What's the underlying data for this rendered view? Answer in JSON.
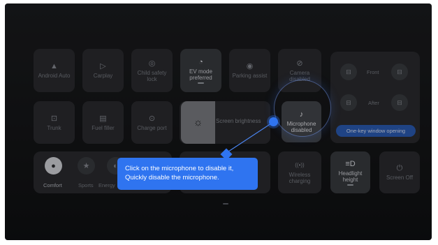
{
  "tiles_row1": [
    {
      "label": "Android Auto",
      "icon": "android-auto-icon",
      "glyph": "▲"
    },
    {
      "label": "Carplay",
      "icon": "carplay-icon",
      "glyph": "▷"
    },
    {
      "label": "Child safety lock",
      "icon": "child-lock-icon",
      "glyph": "◎"
    },
    {
      "label": "EV mode preferred",
      "icon": "ev-mode-icon",
      "glyph": "◔"
    },
    {
      "label": "Parking assist",
      "icon": "parking-assist-icon",
      "glyph": "◉"
    },
    {
      "label": "Camera disabled",
      "icon": "camera-disabled-icon",
      "glyph": "⊘"
    }
  ],
  "tiles_row2": [
    {
      "label": "Trunk",
      "icon": "trunk-icon",
      "glyph": "⊡"
    },
    {
      "label": "Fuel filler",
      "icon": "fuel-filler-icon",
      "glyph": "▤"
    },
    {
      "label": "Charge port",
      "icon": "charge-port-icon",
      "glyph": "⊙"
    }
  ],
  "brightness": {
    "label": "Screen brightness",
    "icon": "sun-icon",
    "glyph": "☼",
    "level_percent": 38
  },
  "microphone": {
    "label": "Microphone disabled",
    "icon": "microphone-disabled-icon",
    "glyph": "♪"
  },
  "window": {
    "front_label": "Front",
    "after_label": "After",
    "one_key_label": "One-key window opening",
    "icon_glyph": "⊟"
  },
  "drive_modes": [
    {
      "label": "Comfort",
      "icon": "comfort-mode-icon",
      "glyph": "●"
    },
    {
      "label": "Sports",
      "icon": "sports-mode-icon",
      "glyph": "★"
    },
    {
      "label": "Energy",
      "icon": "energy-mode-icon",
      "glyph": "◐"
    }
  ],
  "row3": [
    {
      "label": "Wireless charging",
      "icon": "wireless-charging-icon",
      "glyph": "((•))"
    },
    {
      "label": "Headlight height",
      "icon": "headlight-icon",
      "glyph": "≡D"
    },
    {
      "label": "Screen Off",
      "icon": "power-icon",
      "glyph": "⏻"
    }
  ],
  "tooltip": {
    "line1": "Click on the microphone to disable it,",
    "line2": "Quickly disable the microphone."
  },
  "colors": {
    "accent": "#2f74f0",
    "tile": "#2b2c30",
    "background": "#151618"
  }
}
